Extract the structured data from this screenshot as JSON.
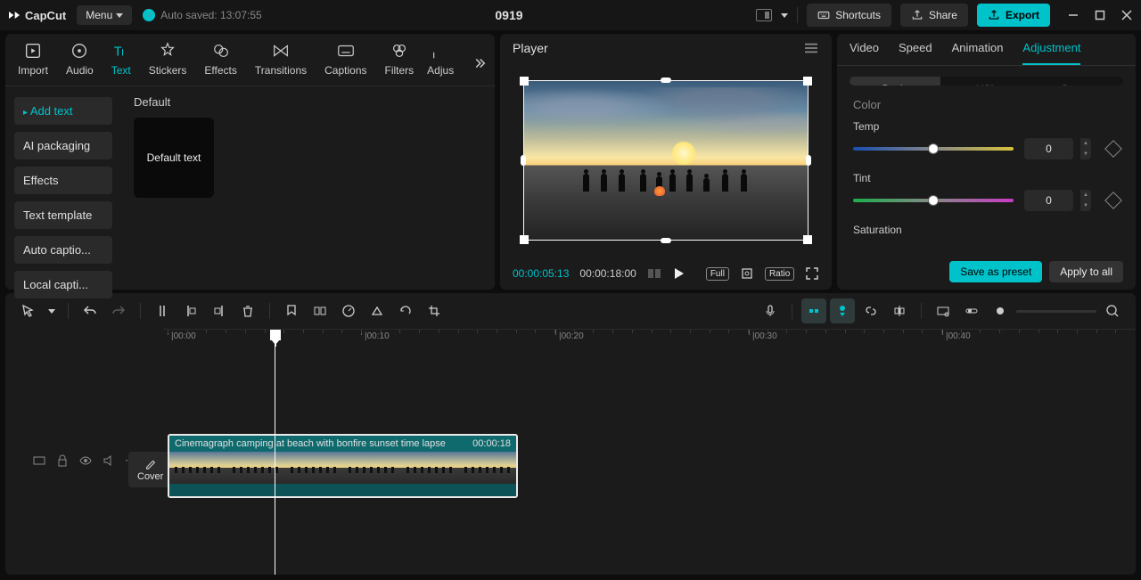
{
  "app": {
    "name": "CapCut"
  },
  "titlebar": {
    "menu_label": "Menu",
    "autosave_label": "Auto saved: 13:07:55",
    "project_title": "0919",
    "shortcuts_label": "Shortcuts",
    "share_label": "Share",
    "export_label": "Export"
  },
  "tool_tabs": {
    "items": [
      {
        "label": "Import",
        "icon": "import"
      },
      {
        "label": "Audio",
        "icon": "audio"
      },
      {
        "label": "Text",
        "icon": "text"
      },
      {
        "label": "Stickers",
        "icon": "stickers"
      },
      {
        "label": "Effects",
        "icon": "effects"
      },
      {
        "label": "Transitions",
        "icon": "transitions"
      },
      {
        "label": "Captions",
        "icon": "captions"
      },
      {
        "label": "Filters",
        "icon": "filters"
      },
      {
        "label": "Adjus",
        "icon": "adjust"
      }
    ],
    "active_index": 2
  },
  "sidemenu": {
    "items": [
      "Add text",
      "AI packaging",
      "Effects",
      "Text template",
      "Auto captio...",
      "Local capti..."
    ],
    "active_index": 0
  },
  "content": {
    "heading": "Default",
    "card_label": "Default text"
  },
  "player": {
    "title": "Player",
    "time_current": "00:00:05:13",
    "time_total": "00:00:18:00",
    "full_label": "Full",
    "ratio_label": "Ratio"
  },
  "properties": {
    "tabs": [
      "Video",
      "Speed",
      "Animation",
      "Adjustment"
    ],
    "active_tab_index": 3,
    "sub_tabs": [
      "Basic",
      "HSL",
      "Curves"
    ],
    "active_sub_index": 0,
    "section_color": "Color",
    "rows": {
      "temp": {
        "label": "Temp",
        "value": "0"
      },
      "tint": {
        "label": "Tint",
        "value": "0"
      },
      "saturation": {
        "label": "Saturation"
      }
    },
    "save_preset_label": "Save as preset",
    "apply_all_label": "Apply to all"
  },
  "ruler": {
    "ticks": [
      "00:00",
      "00:10",
      "00:20",
      "00:30",
      "00:40"
    ]
  },
  "clip": {
    "name": "Cinemagraph camping at beach with bonfire sunset time lapse",
    "duration": "00:00:18"
  },
  "cover_label": "Cover"
}
